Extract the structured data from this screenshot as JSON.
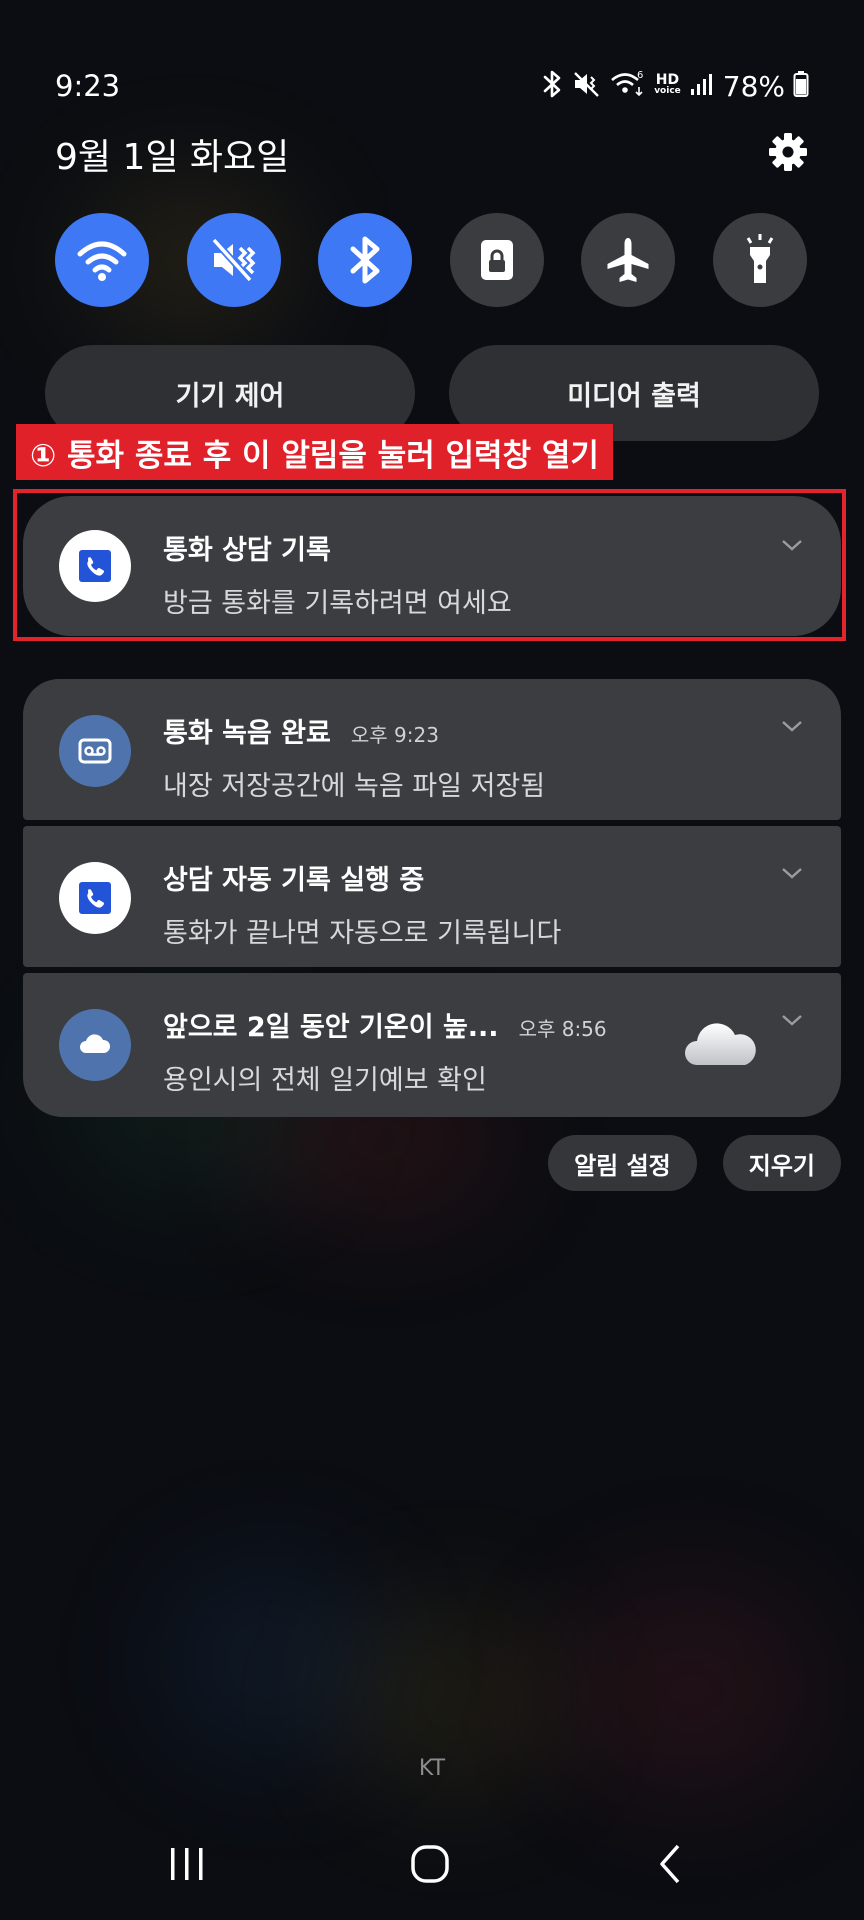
{
  "status_bar": {
    "time": "9:23",
    "battery": "78%",
    "hd_label": "HD",
    "voice_label": "voice",
    "icons": [
      "bluetooth-icon",
      "mute-vibrate-icon",
      "wifi6-icon",
      "hd-voice-icon",
      "signal-icon",
      "battery-icon"
    ]
  },
  "header": {
    "date": "9월 1일 화요일",
    "settings_icon": "gear-icon"
  },
  "quick_toggles": [
    {
      "name": "wifi",
      "icon": "wifi-icon",
      "state": "on"
    },
    {
      "name": "sound",
      "icon": "vibrate-mute-icon",
      "state": "on"
    },
    {
      "name": "bluetooth",
      "icon": "bluetooth-icon",
      "state": "on"
    },
    {
      "name": "rotation-lock",
      "icon": "lock-icon",
      "state": "off"
    },
    {
      "name": "airplane",
      "icon": "airplane-icon",
      "state": "off"
    },
    {
      "name": "flashlight",
      "icon": "flashlight-icon",
      "state": "off"
    }
  ],
  "pills": {
    "device_control": "기기 제어",
    "media_output": "미디어 출력"
  },
  "annotation": {
    "callout": "① 통화 종료 후 이 알림을 눌러 입력창 열기"
  },
  "notifications": [
    {
      "title": "통화 상담 기록",
      "time": "",
      "body": "방금 통화를 기록하려면 여세요",
      "icon": "phone-app-icon"
    },
    {
      "title": "통화 녹음 완료",
      "time": "오후 9:23",
      "body": "내장 저장공간에 녹음 파일 저장됨",
      "icon": "voicemail-icon"
    },
    {
      "title": "상담 자동 기록 실행 중",
      "time": "",
      "body": "통화가 끝나면 자동으로 기록됩니다",
      "icon": "phone-app-icon"
    },
    {
      "title": "앞으로 2일 동안 기온이 높...",
      "time": "오후 8:56",
      "body": "용인시의 전체 일기예보 확인",
      "icon": "cloud-icon"
    }
  ],
  "actions": {
    "notification_settings": "알림 설정",
    "clear": "지우기"
  },
  "carrier": "KT",
  "colors": {
    "accent": "#3e78f5",
    "highlight": "#e2242c",
    "card_bg": "#3b3d41"
  }
}
